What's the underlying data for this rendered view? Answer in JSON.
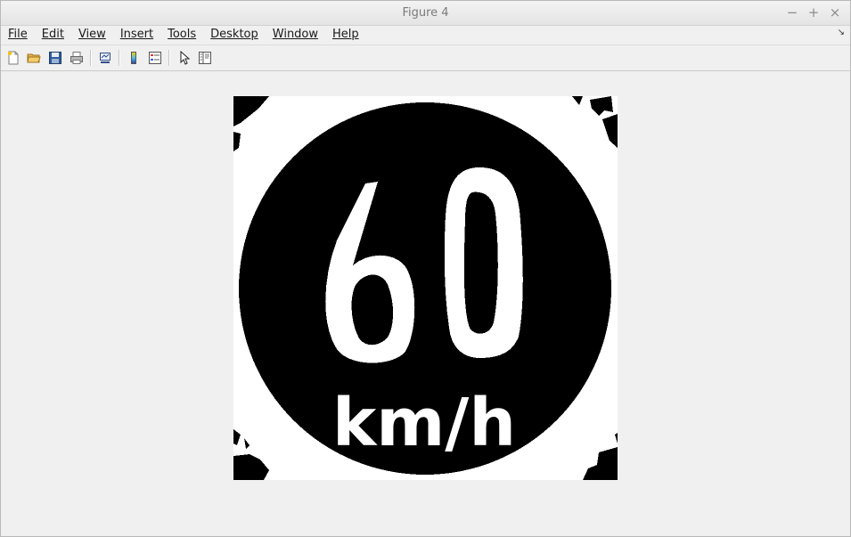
{
  "window": {
    "title": "Figure 4",
    "controls": {
      "minimize": "−",
      "maximize": "+",
      "close": "×"
    }
  },
  "menubar": {
    "items": [
      {
        "label": "File",
        "accesskey": "F"
      },
      {
        "label": "Edit",
        "accesskey": "E"
      },
      {
        "label": "View",
        "accesskey": "V"
      },
      {
        "label": "Insert",
        "accesskey": "I"
      },
      {
        "label": "Tools",
        "accesskey": "T"
      },
      {
        "label": "Desktop",
        "accesskey": "D"
      },
      {
        "label": "Window",
        "accesskey": "W"
      },
      {
        "label": "Help",
        "accesskey": "H"
      }
    ]
  },
  "toolbar": {
    "buttons": [
      {
        "name": "new-figure",
        "icon": "new-document-icon"
      },
      {
        "name": "open-file",
        "icon": "folder-open-icon"
      },
      {
        "name": "save-figure",
        "icon": "save-disk-icon"
      },
      {
        "name": "print-figure",
        "icon": "printer-icon"
      },
      {
        "name": "link-plot",
        "icon": "link-plot-icon"
      },
      {
        "name": "insert-colorbar",
        "icon": "colorbar-icon"
      },
      {
        "name": "insert-legend",
        "icon": "legend-icon"
      },
      {
        "name": "edit-plot",
        "icon": "pointer-arrow-icon"
      },
      {
        "name": "show-plot-tools",
        "icon": "plot-tools-icon"
      }
    ]
  },
  "figure": {
    "sign_number": "60",
    "sign_unit": "km/h",
    "colors": {
      "foreground": "#000000",
      "background": "#ffffff"
    }
  }
}
